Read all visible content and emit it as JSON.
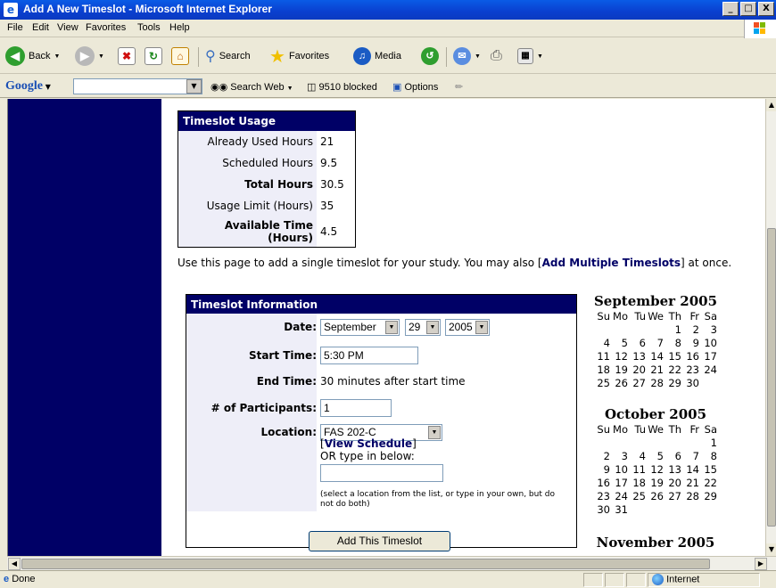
{
  "window": {
    "title": "Add A New Timeslot - Microsoft Internet Explorer",
    "buttons": [
      "_",
      "□",
      "X"
    ]
  },
  "menu": [
    "File",
    "Edit",
    "View",
    "Favorites",
    "Tools",
    "Help"
  ],
  "toolbar": {
    "back": "Back",
    "search": "Search",
    "favorites": "Favorites",
    "media": "Media"
  },
  "googlebar": {
    "logo": "Google",
    "search_web": "Search Web",
    "blocked": "9510 blocked",
    "options": "Options"
  },
  "usage": {
    "title": "Timeslot Usage",
    "rows": [
      {
        "label": "Already Used Hours",
        "value": "21",
        "bold": false
      },
      {
        "label": "Scheduled Hours",
        "value": "9.5",
        "bold": false
      },
      {
        "label": "Total Hours",
        "value": "30.5",
        "bold": true
      },
      {
        "label": "Usage Limit (Hours)",
        "value": "35",
        "bold": false
      },
      {
        "label": "Available Time (Hours)",
        "value": "4.5",
        "bold": true
      }
    ]
  },
  "intro": {
    "before": "Use this page to add a single timeslot for your study. You may also [",
    "link": "Add Multiple Timeslots",
    "after": "] at once."
  },
  "form": {
    "title": "Timeslot Information",
    "date_label": "Date:",
    "month": "September",
    "day": "29",
    "year": "2005",
    "start_label": "Start Time:",
    "start_value": "5:30 PM",
    "end_label": "End Time:",
    "end_value": "30 minutes after start time",
    "participants_label": "# of Participants:",
    "participants_value": "1",
    "location_label": "Location:",
    "location_value": "FAS 202-C",
    "view_schedule_open": "[",
    "view_schedule": "View Schedule",
    "view_schedule_close": "]",
    "or_type": "OR type in below:",
    "other_location": "",
    "note": "(select a location from the list, or type in your own, but do not do both)",
    "submit": "Add This Timeslot"
  },
  "calendars": [
    {
      "title": "September 2005",
      "weekdays": [
        "Su",
        "Mo",
        "Tu",
        "We",
        "Th",
        "Fr",
        "Sa"
      ],
      "weeks": [
        [
          "",
          "",
          "",
          "",
          "1",
          "2",
          "3"
        ],
        [
          "4",
          "5",
          "6",
          "7",
          "8",
          "9",
          "10"
        ],
        [
          "11",
          "12",
          "13",
          "14",
          "15",
          "16",
          "17"
        ],
        [
          "18",
          "19",
          "20",
          "21",
          "22",
          "23",
          "24"
        ],
        [
          "25",
          "26",
          "27",
          "28",
          "29",
          "30",
          ""
        ]
      ]
    },
    {
      "title": "October 2005",
      "weekdays": [
        "Su",
        "Mo",
        "Tu",
        "We",
        "Th",
        "Fr",
        "Sa"
      ],
      "weeks": [
        [
          "",
          "",
          "",
          "",
          "",
          "",
          "1"
        ],
        [
          "2",
          "3",
          "4",
          "5",
          "6",
          "7",
          "8"
        ],
        [
          "9",
          "10",
          "11",
          "12",
          "13",
          "14",
          "15"
        ],
        [
          "16",
          "17",
          "18",
          "19",
          "20",
          "21",
          "22"
        ],
        [
          "23",
          "24",
          "25",
          "26",
          "27",
          "28",
          "29"
        ],
        [
          "30",
          "31",
          "",
          "",
          "",
          "",
          ""
        ]
      ]
    },
    {
      "title": "November 2005"
    }
  ],
  "status": {
    "text": "Done",
    "zone": "Internet"
  }
}
